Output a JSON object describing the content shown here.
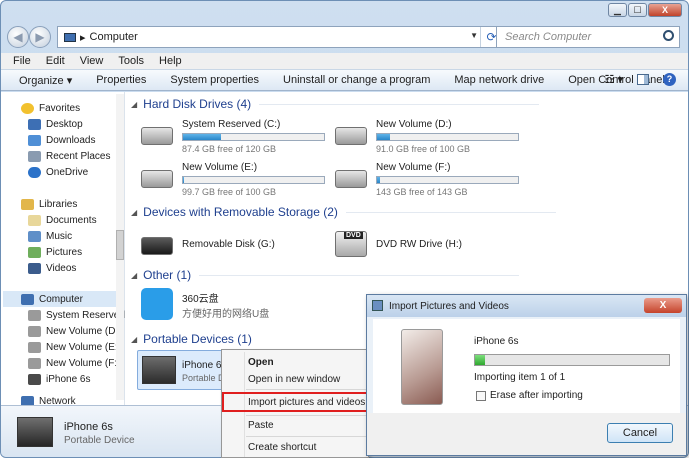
{
  "window": {
    "close_glyph": "X",
    "min_glyph": "▁",
    "max_glyph": "☐"
  },
  "address": {
    "back_glyph": "◀",
    "forward_glyph": "▶",
    "root_glyph": "▸",
    "path": "Computer",
    "search_placeholder": "Search Computer"
  },
  "menubar": [
    "File",
    "Edit",
    "View",
    "Tools",
    "Help"
  ],
  "toolbar": {
    "organize": "Organize ▾",
    "items": [
      "Properties",
      "System properties",
      "Uninstall or change a program",
      "Map network drive",
      "Open Control Panel"
    ],
    "view_glyph": "☷ ▾",
    "help_glyph": "?"
  },
  "nav": {
    "favorites": "Favorites",
    "fav_items": [
      "Desktop",
      "Downloads",
      "Recent Places",
      "OneDrive"
    ],
    "libraries": "Libraries",
    "lib_items": [
      "Documents",
      "Music",
      "Pictures",
      "Videos"
    ],
    "computer": "Computer",
    "comp_items": [
      "System Reserved",
      "New Volume (D:)",
      "New Volume (E:)",
      "New Volume (F:)",
      "iPhone 6s"
    ],
    "network": "Network"
  },
  "sections": {
    "hdd": "Hard Disk Drives (4)",
    "removable": "Devices with Removable Storage (2)",
    "other": "Other (1)",
    "portable": "Portable Devices (1)"
  },
  "drives": [
    {
      "name": "System Reserved (C:)",
      "free": "87.4 GB free of 120 GB",
      "used_fraction": 0.27
    },
    {
      "name": "New Volume (D:)",
      "free": "91.0 GB free of 100 GB",
      "used_fraction": 0.09
    },
    {
      "name": "New Volume (E:)",
      "free": "99.7 GB free of 100 GB",
      "used_fraction": 0.01
    },
    {
      "name": "New Volume (F:)",
      "free": "143 GB free of 143 GB",
      "used_fraction": 0.02
    }
  ],
  "removable": [
    "Removable Disk (G:)",
    "DVD RW Drive (H:)"
  ],
  "dvd_badge": "DVD",
  "other_item": {
    "name": "360云盘",
    "desc": "方便好用的网络U盘"
  },
  "portable_item": {
    "name": "iPhone 6s",
    "desc": "Portable D"
  },
  "context_menu": [
    "Open",
    "Open in new window",
    "Import pictures and videos",
    "Paste",
    "Create shortcut"
  ],
  "statusbar": {
    "name": "iPhone 6s",
    "desc": "Portable Device"
  },
  "dialog": {
    "title": "Import Pictures and Videos",
    "close": "X",
    "device": "iPhone 6s",
    "progress": 0.05,
    "status": "Importing item 1 of 1",
    "erase_label": "Erase after importing",
    "cancel": "Cancel"
  },
  "colors": {
    "accent_link": "#1e3f8e",
    "highlight_border": "#e01e1e",
    "progress_green": "#3dbb3d"
  }
}
